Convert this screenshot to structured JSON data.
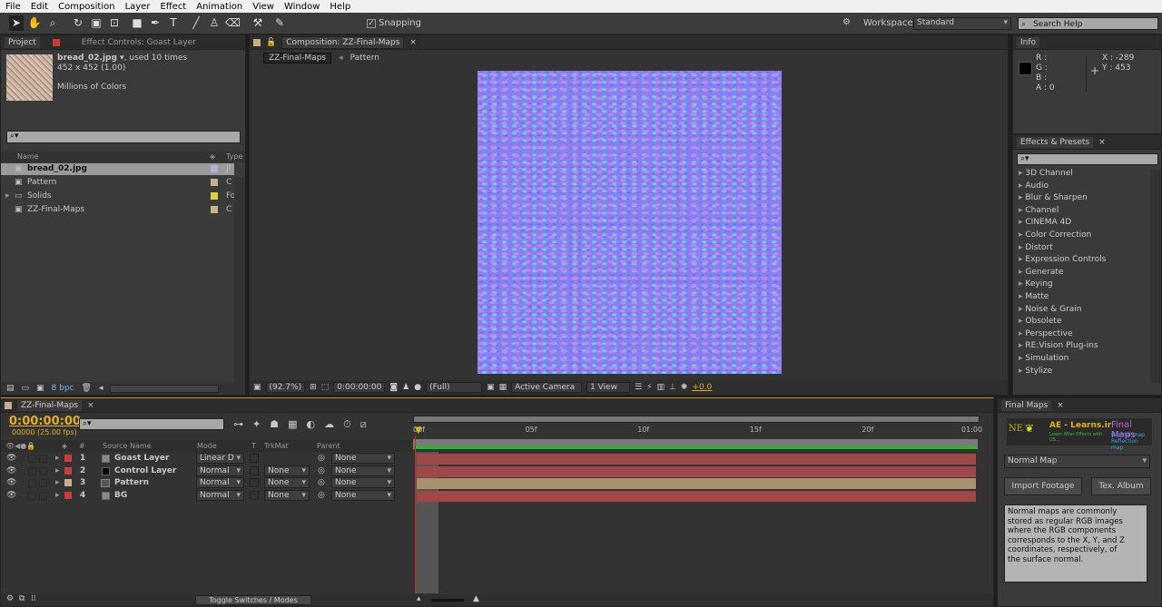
{
  "menu": [
    "File",
    "Edit",
    "Composition",
    "Layer",
    "Effect",
    "Animation",
    "View",
    "Window",
    "Help"
  ],
  "toolbar": {
    "snapping_label": "Snapping",
    "snapping_checked": true,
    "workspace_label": "Workspace:",
    "workspace_value": "Standard",
    "search_placeholder": "Search Help"
  },
  "project": {
    "tab": "Project",
    "effect_tab": "Effect Controls: Goast Layer",
    "file_name": "bread_02.jpg ▾",
    "used": ", used 10 times",
    "dimensions": "452 x 452 (1.00)",
    "colors": "Millions of Colors",
    "col_name": "Name",
    "col_type": "Type",
    "bpc": "8 bpc",
    "items": [
      {
        "name": "bread_02.jpg",
        "type": "JI",
        "color": "#b4b0d8",
        "icon": "image-icon",
        "selected": true
      },
      {
        "name": "Pattern",
        "type": "C",
        "color": "#c8b08a",
        "icon": "composition-icon"
      },
      {
        "name": "Solids",
        "type": "Fo",
        "color": "#e0d040",
        "icon": "folder-icon"
      },
      {
        "name": "ZZ-Final-Maps",
        "type": "C",
        "color": "#c8b08a",
        "icon": "composition-icon"
      }
    ]
  },
  "composition": {
    "tab": "Composition: ZZ-Final-Maps",
    "breadcrumb": [
      "ZZ-Final-Maps",
      "Pattern"
    ],
    "zoom": "(92.7%)",
    "timecode": "0:00:00:00",
    "resolution": "(Full)",
    "camera": "Active Camera",
    "views": "1 View",
    "exposure": "+0.0"
  },
  "info": {
    "tab": "Info",
    "r": "R :",
    "g": "G :",
    "b": "B :",
    "a": "A : 0",
    "x": "X : -289",
    "y": "Y : 453"
  },
  "effects": {
    "tab": "Effects & Presets",
    "items": [
      "3D Channel",
      "Audio",
      "Blur & Sharpen",
      "Channel",
      "CINEMA 4D",
      "Color Correction",
      "Distort",
      "Expression Controls",
      "Generate",
      "Keying",
      "Matte",
      "Noise & Grain",
      "Obsolete",
      "Perspective",
      "RE:Vision Plug-ins",
      "Simulation",
      "Stylize"
    ]
  },
  "timeline": {
    "tab": "ZZ-Final-Maps",
    "timecode": "0:00:00:00",
    "fps": "00000 (25.00 fps)",
    "headers": {
      "num": "#",
      "source": "Source Name",
      "mode": "Mode",
      "t": "T",
      "trkmat": "TrkMat",
      "parent": "Parent"
    },
    "ruler": [
      "00f",
      "05f",
      "10f",
      "15f",
      "20f",
      "01:00"
    ],
    "layers": [
      {
        "num": "1",
        "name": "Goast Layer",
        "label": "#c83c3c",
        "swatch": "#888",
        "mode": "Linear D",
        "trkmat": "",
        "parent": "None",
        "bar": "#a04848"
      },
      {
        "num": "2",
        "name": "Control Layer",
        "label": "#c83c3c",
        "swatch": "#000",
        "mode": "Normal",
        "trkmat": "None",
        "parent": "None",
        "bar": "#a04848"
      },
      {
        "num": "3",
        "name": "Pattern",
        "label": "#c8b08a",
        "swatch": "comp",
        "mode": "Normal",
        "trkmat": "None",
        "parent": "None",
        "bar": "#a89070"
      },
      {
        "num": "4",
        "name": "BG",
        "label": "#c83c3c",
        "swatch": "#888",
        "mode": "Normal",
        "trkmat": "None",
        "parent": "None",
        "bar": "#a04848"
      }
    ],
    "toggle": "Toggle Switches / Modes"
  },
  "finalmaps": {
    "tab": "Final Maps",
    "logo_site": "AE - Learns.ir",
    "logo_tagline": "Learn After Effects with US...",
    "logo_title": "Final Maps",
    "logo_sub1": "Normal map",
    "logo_sub2": "Reflection map",
    "map_type": "Normal Map",
    "import_btn": "Import Footage",
    "album_btn": "Tex. Album",
    "description": "Normal maps are commonly stored as regular RGB images where the RGB components corresponds to the X, Y, and Z coordinates, respectively, of the surface normal."
  }
}
